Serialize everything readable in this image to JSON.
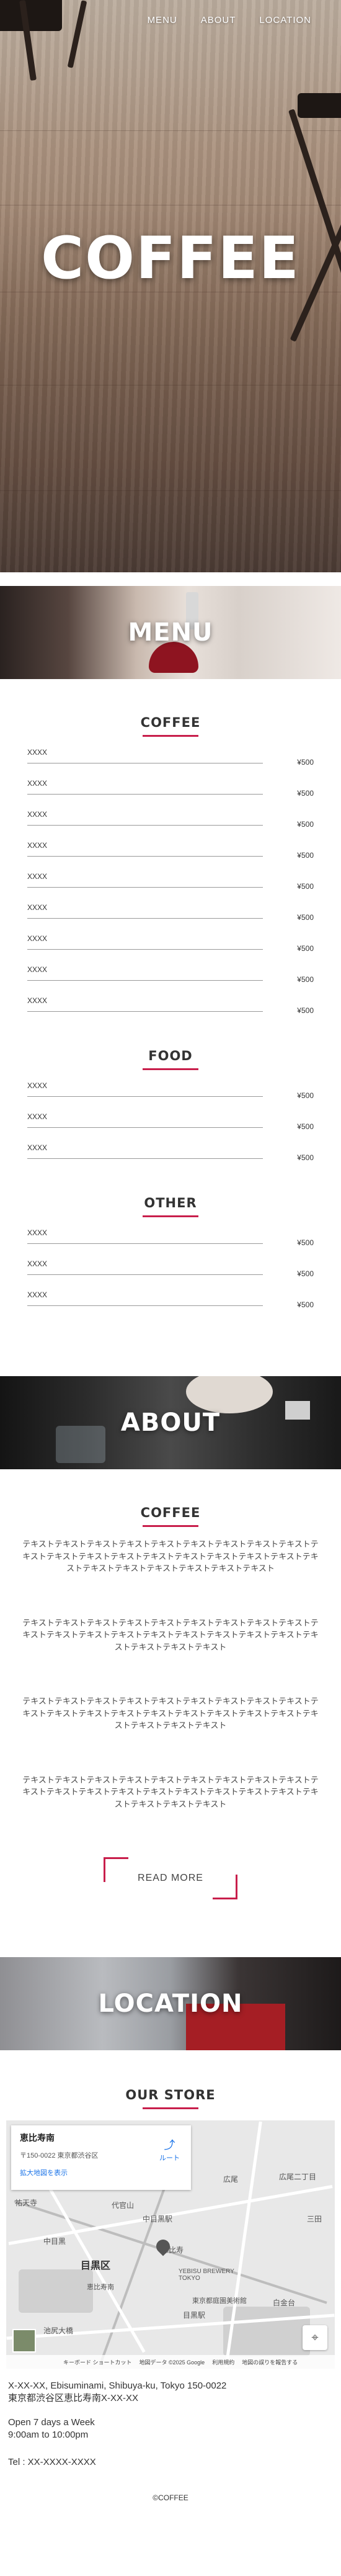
{
  "nav": {
    "items": [
      "MENU",
      "ABOUT",
      "LOCATION"
    ]
  },
  "hero": {
    "title": "COFFEE"
  },
  "menu_section": {
    "banner": "MENU",
    "groups": [
      {
        "heading": "COFFEE",
        "items": [
          {
            "name": "XXXX",
            "price": "¥500"
          },
          {
            "name": "XXXX",
            "price": "¥500"
          },
          {
            "name": "XXXX",
            "price": "¥500"
          },
          {
            "name": "XXXX",
            "price": "¥500"
          },
          {
            "name": "XXXX",
            "price": "¥500"
          },
          {
            "name": "XXXX",
            "price": "¥500"
          },
          {
            "name": "XXXX",
            "price": "¥500"
          },
          {
            "name": "XXXX",
            "price": "¥500"
          },
          {
            "name": "XXXX",
            "price": "¥500"
          }
        ]
      },
      {
        "heading": "FOOD",
        "items": [
          {
            "name": "XXXX",
            "price": "¥500"
          },
          {
            "name": "XXXX",
            "price": "¥500"
          },
          {
            "name": "XXXX",
            "price": "¥500"
          }
        ]
      },
      {
        "heading": "OTHER",
        "items": [
          {
            "name": "XXXX",
            "price": "¥500"
          },
          {
            "name": "XXXX",
            "price": "¥500"
          },
          {
            "name": "XXXX",
            "price": "¥500"
          }
        ]
      }
    ]
  },
  "about_section": {
    "banner": "ABOUT",
    "heading": "COFFEE",
    "paragraphs": [
      "テキストテキストテキストテキストテキストテキストテキストテキストテキストテキストテキストテキストテキストテキストテキストテキストテキストテキストテキストテキストテキストテキストテキストテキストテキスト",
      "テキストテキストテキストテキストテキストテキストテキストテキストテキストテキストテキストテキストテキストテキストテキストテキストテキストテキストテキストテキストテキストテキスト",
      "テキストテキストテキストテキストテキストテキストテキストテキストテキストテキストテキストテキストテキストテキストテキストテキストテキストテキストテキストテキストテキストテキスト",
      "テキストテキストテキストテキストテキストテキストテキストテキストテキストテキストテキストテキストテキストテキストテキストテキストテキストテキストテキストテキストテキストテキスト"
    ],
    "read_more": "READ MORE"
  },
  "location_section": {
    "banner": "LOCATION",
    "heading": "OUR STORE",
    "map": {
      "place_name": "恵比寿南",
      "place_address": "〒150-0022 東京都渋谷区",
      "enlarge_link": "拡大地図を表示",
      "route_label": "ルート",
      "labels": [
        "目黒区",
        "中目黒",
        "代官山",
        "恵比寿",
        "広尾",
        "広尾二丁目",
        "YEBISU BREWERY TOKYO",
        "東京都庭園美術館",
        "白金台",
        "目黒駅",
        "祐天寺",
        "中目黒駅",
        "池尻大橋",
        "恵比寿南",
        "三田"
      ],
      "footer_items": [
        "キーボード ショートカット",
        "地図データ ©2025 Google",
        "利用規約",
        "地図の誤りを報告する"
      ]
    },
    "address_en": "X-XX-XX, Ebisuminami, Shibuya-ku, Tokyo 150-0022",
    "address_jp": "東京都渋谷区恵比寿南X-XX-XX",
    "hours_1": "Open 7 days a Week",
    "hours_2": "9:00am to 10:00pm",
    "tel": "Tel : XX-XXXX-XXXX"
  },
  "footer": {
    "copyright": "©COFFEE"
  },
  "colors": {
    "accent": "#c81e4b"
  }
}
